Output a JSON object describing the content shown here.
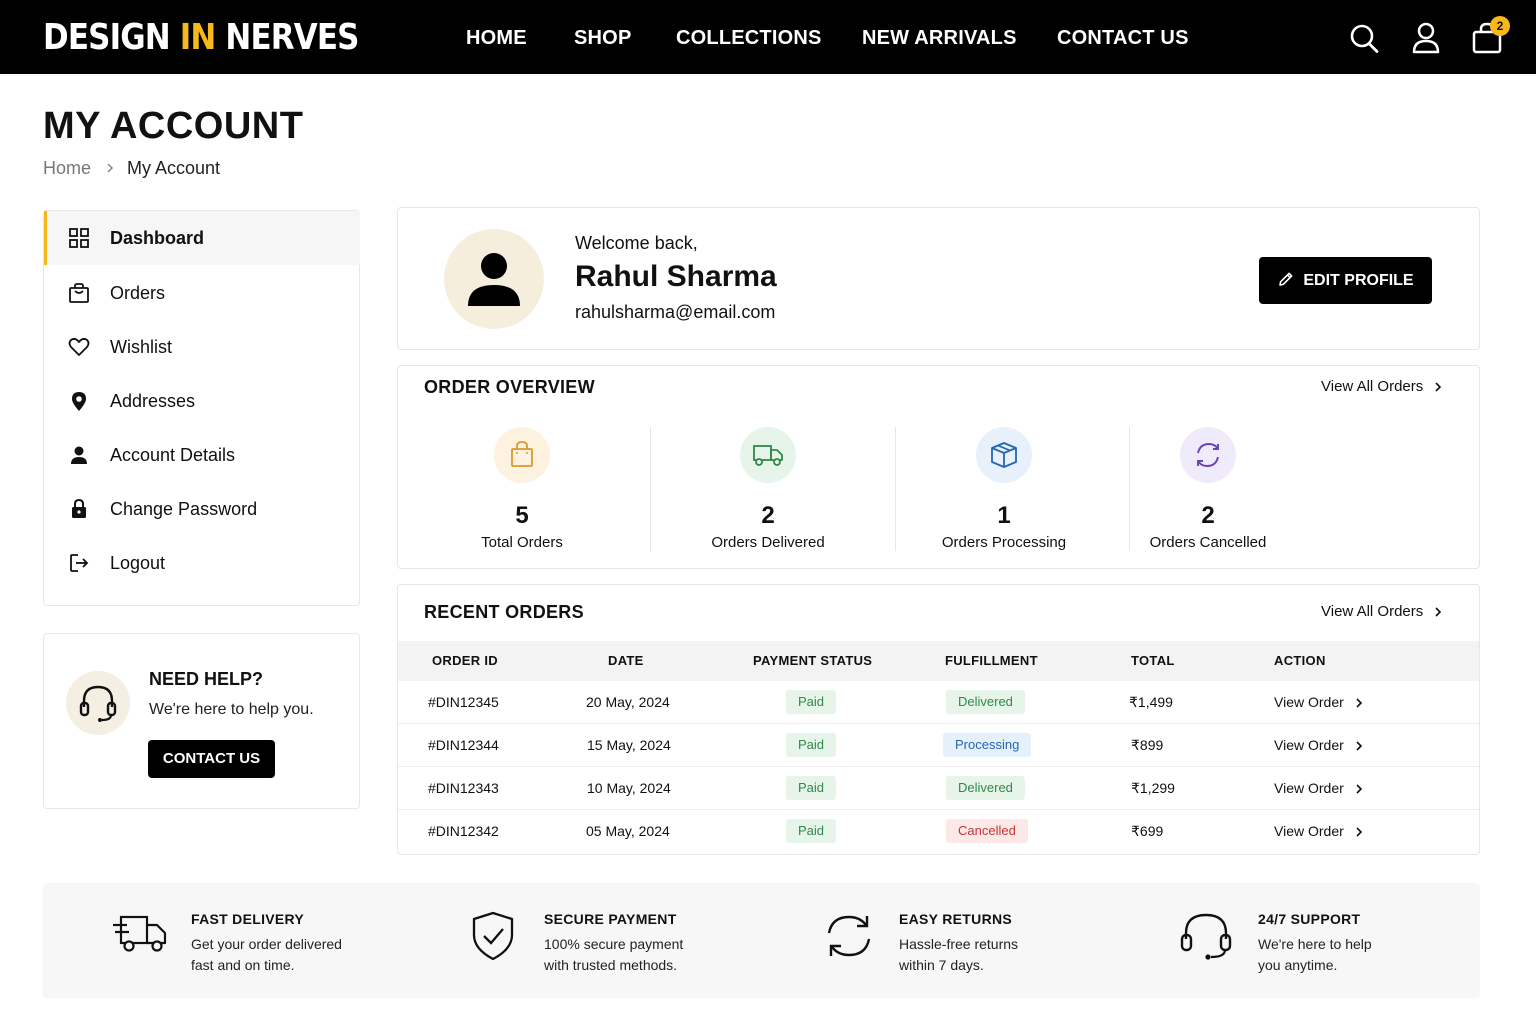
{
  "brand": {
    "part1": "DESIGN",
    "part2": "IN",
    "part3": "NERVES",
    "accent_color": "#f6b81a"
  },
  "nav": {
    "home": "HOME",
    "shop": "SHOP",
    "collections": "COLLECTIONS",
    "new_arrivals": "NEW ARRIVALS",
    "contact": "CONTACT US"
  },
  "header_icons": [
    "search-icon",
    "user-icon",
    "cart-icon"
  ],
  "cart": {
    "count": "2"
  },
  "page": {
    "title": "MY ACCOUNT",
    "breadcrumb": [
      "Home",
      "My Account"
    ]
  },
  "sidebar": {
    "items": [
      {
        "label": "Dashboard",
        "icon": "grid-icon",
        "active": true
      },
      {
        "label": "Orders",
        "icon": "bag-icon"
      },
      {
        "label": "Wishlist",
        "icon": "heart-icon"
      },
      {
        "label": "Addresses",
        "icon": "location-pin-icon"
      },
      {
        "label": "Account Details",
        "icon": "user-icon"
      },
      {
        "label": "Change Password",
        "icon": "lock-icon"
      },
      {
        "label": "Logout",
        "icon": "logout-icon"
      }
    ]
  },
  "help": {
    "title": "NEED HELP?",
    "subtitle": "We're here to help you.",
    "button": "CONTACT US"
  },
  "profile": {
    "welcome": "Welcome back,",
    "name": "Rahul Sharma",
    "email": "rahulsharma@email.com",
    "edit_button": "EDIT PROFILE"
  },
  "overview": {
    "title": "ORDER OVERVIEW",
    "view_all": "View All Orders",
    "stats": [
      {
        "value": "5",
        "label": "Total Orders",
        "icon": "shopping-bag-icon",
        "bg": "#fdf1df",
        "color": "#d79a2b"
      },
      {
        "value": "2",
        "label": "Orders Delivered",
        "icon": "delivery-truck-icon",
        "bg": "#e7f4ea",
        "color": "#2f8a47"
      },
      {
        "value": "1",
        "label": "Orders Processing",
        "icon": "package-box-icon",
        "bg": "#e7f0fb",
        "color": "#2466b2"
      },
      {
        "value": "2",
        "label": "Orders Cancelled",
        "icon": "refresh-icon",
        "bg": "#f0ebfa",
        "color": "#6a43b5"
      }
    ]
  },
  "recent": {
    "title": "RECENT ORDERS",
    "view_all": "View All Orders",
    "columns": [
      "ORDER ID",
      "DATE",
      "PAYMENT STATUS",
      "FULFILLMENT",
      "TOTAL",
      "ACTION"
    ],
    "rows": [
      {
        "id": "#DIN12345",
        "date": "20 May, 2024",
        "payment": "Paid",
        "fulfillment": "Delivered",
        "total": "₹1,499",
        "action": "View Order"
      },
      {
        "id": "#DIN12344",
        "date": "15 May, 2024",
        "payment": "Paid",
        "fulfillment": "Processing",
        "total": "₹899",
        "action": "View Order"
      },
      {
        "id": "#DIN12343",
        "date": "10 May, 2024",
        "payment": "Paid",
        "fulfillment": "Delivered",
        "total": "₹1,299",
        "action": "View Order"
      },
      {
        "id": "#DIN12342",
        "date": "05 May, 2024",
        "payment": "Paid",
        "fulfillment": "Cancelled",
        "total": "₹699",
        "action": "View Order"
      }
    ]
  },
  "features": [
    {
      "title": "FAST DELIVERY",
      "line1": "Get your order delivered",
      "line2": "fast and on time.",
      "icon": "delivery-truck-icon"
    },
    {
      "title": "SECURE PAYMENT",
      "line1": "100% secure payment",
      "line2": "with trusted methods.",
      "icon": "shield-check-icon"
    },
    {
      "title": "EASY RETURNS",
      "line1": "Hassle-free returns",
      "line2": "within 7 days.",
      "icon": "refresh-icon"
    },
    {
      "title": "24/7 SUPPORT",
      "line1": "We're here to help",
      "line2": "you anytime.",
      "icon": "headset-icon"
    }
  ]
}
